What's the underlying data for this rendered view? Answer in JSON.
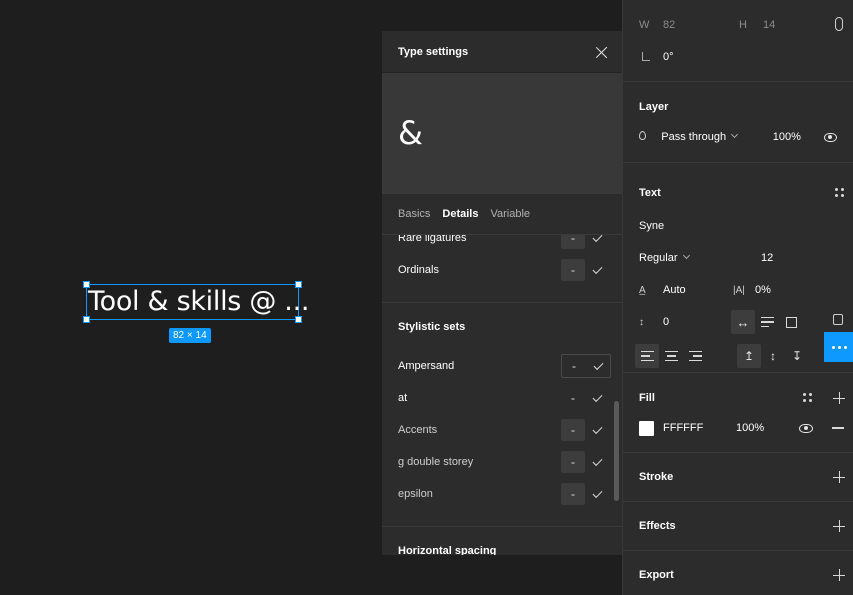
{
  "canvas": {
    "selected_text": "Tool & skills @ ...",
    "dimensions_badge": "82 × 14"
  },
  "type_settings": {
    "title": "Type settings",
    "preview_glyph": "&",
    "tabs": [
      {
        "label": "Basics",
        "active": false
      },
      {
        "label": "Details",
        "active": true
      },
      {
        "label": "Variable",
        "active": false
      }
    ],
    "rows_top": [
      {
        "label": "Rare ligatures"
      },
      {
        "label": "Ordinals"
      }
    ],
    "stylistic_sets_title": "Stylistic sets",
    "stylistic_sets": [
      {
        "label": "Ampersand"
      },
      {
        "label": "at"
      },
      {
        "label": "Accents"
      },
      {
        "label": "g double storey"
      },
      {
        "label": "epsilon"
      }
    ],
    "horizontal_spacing_title": "Horizontal spacing",
    "off_symbol": "-"
  },
  "props": {
    "w_label": "W",
    "w_value": "82",
    "h_label": "H",
    "h_value": "14",
    "rotation": "0°",
    "layer": {
      "title": "Layer",
      "blend": "Pass through",
      "opacity": "100%"
    },
    "text": {
      "title": "Text",
      "font": "Syne",
      "weight": "Regular",
      "size": "12",
      "line_height": "Auto",
      "letter_spacing": "0%",
      "paragraph_spacing": "0"
    },
    "fill": {
      "title": "Fill",
      "hex": "FFFFFF",
      "opacity": "100%",
      "color": "#ffffff"
    },
    "stroke_title": "Stroke",
    "effects_title": "Effects",
    "export_title": "Export"
  },
  "colors": {
    "accent": "#0d99ff",
    "panel": "#2c2c2c",
    "canvas": "#1e1e1e"
  }
}
